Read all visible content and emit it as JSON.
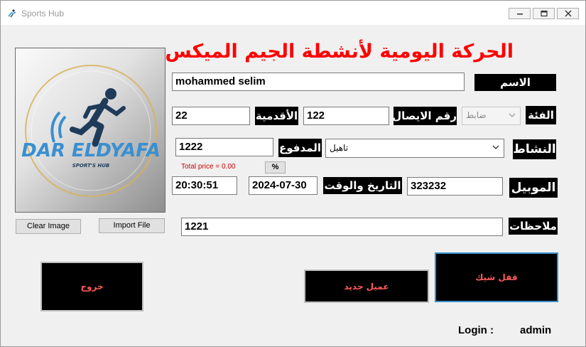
{
  "window": {
    "title": "Sports Hub",
    "minimize_icon": "minimize-icon",
    "maximize_icon": "maximize-icon",
    "close_icon": "close-icon"
  },
  "header": {
    "title": "الحركة اليومية لأنشطة الجيم الميكس"
  },
  "logo": {
    "brand": "DAR ELDYAFA",
    "tagline": "SPORT'S HUB",
    "colors": {
      "blue": "#3a8fd0",
      "navy": "#1f3b5a",
      "gold": "#d6b35a"
    }
  },
  "image_buttons": {
    "clear": "Clear Image",
    "import": "Import File"
  },
  "form": {
    "name": {
      "label": "الاسم",
      "value": "mohammed selim"
    },
    "category": {
      "label": "الفئة",
      "value": "ضابط"
    },
    "receipt": {
      "label": "رقم الايصال",
      "value": "122"
    },
    "seniority": {
      "label": "الأقدمية",
      "value": "22"
    },
    "activity": {
      "label": "النشاط",
      "value": "تاهيل"
    },
    "paid": {
      "label": "المدفوع",
      "value": "1222"
    },
    "total_price": "Total price = 0.00",
    "percent_button": "%",
    "mobile": {
      "label": "الموبيل",
      "value": "323232"
    },
    "datetime": {
      "label": "التاريخ والوقت",
      "date": "2024-07-30",
      "time": "20:30:51"
    },
    "notes": {
      "label": "ملاحظات",
      "value": "1221"
    }
  },
  "actions": {
    "exit": "خروج",
    "new_client": "عميل جديد",
    "close_cheque": "قفل شيك"
  },
  "status": {
    "login_label": "Login :",
    "user": "admin"
  },
  "colors": {
    "label_bg": "#000000",
    "title_red": "#ff0000",
    "button_text": "#ff5a5a"
  }
}
